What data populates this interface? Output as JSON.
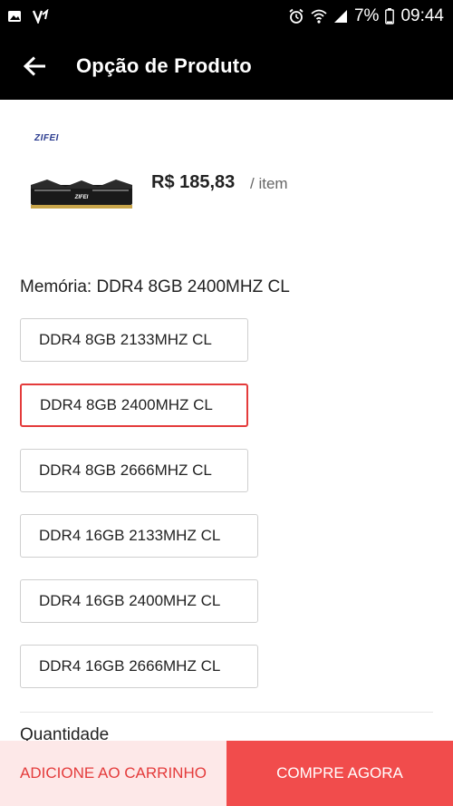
{
  "status_bar": {
    "battery_percent": "7%",
    "time": "09:44",
    "icons": [
      "gallery-icon",
      "app-notification-icon",
      "alarm-icon",
      "wifi-icon",
      "signal-icon",
      "battery-icon"
    ]
  },
  "header": {
    "title": "Opção de Produto",
    "back_icon": "arrow-left-icon"
  },
  "product": {
    "brand": "ZIFEI",
    "image_label": "ZIFEI",
    "price": "R$ 185,83",
    "per_item": "/ item"
  },
  "memory": {
    "label": "Memória: DDR4 8GB 2400MHZ CL",
    "selected_index": 1,
    "options": [
      {
        "label": "DDR4 8GB 2133MHZ CL"
      },
      {
        "label": "DDR4 8GB 2400MHZ CL"
      },
      {
        "label": "DDR4 8GB 2666MHZ CL"
      },
      {
        "label": "DDR4 16GB 2133MHZ CL"
      },
      {
        "label": "DDR4 16GB 2400MHZ CL"
      },
      {
        "label": "DDR4 16GB 2666MHZ CL"
      }
    ]
  },
  "quantity": {
    "label": "Quantidade"
  },
  "actions": {
    "add_to_cart": "ADICIONE AO CARRINHO",
    "buy_now": "COMPRE AGORA"
  },
  "colors": {
    "accent": "#f14c4c",
    "selected_border": "#e43b3b",
    "header_bg": "#000000"
  }
}
